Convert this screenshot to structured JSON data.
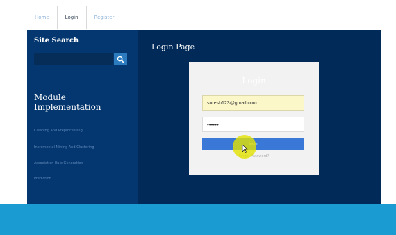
{
  "nav": {
    "tabs": [
      "Home",
      "Login",
      "Register"
    ],
    "active_index": 1
  },
  "sidebar": {
    "search_title": "Site Search",
    "search_placeholder": "",
    "search_icon": "search-icon",
    "module_heading": "Module Implementation",
    "links": [
      "Cleaning And Preprocessing",
      "Incremental Mining And Clustering",
      "Association Rule Generation",
      "Prediction"
    ]
  },
  "main": {
    "title": "Login Page",
    "login": {
      "heading": "Login",
      "email_value": "suresh123@gmail.com",
      "password_value": "••••••",
      "button_label": "login",
      "forgot_label": "Forgot Password?"
    }
  },
  "colors": {
    "sidebar_bg": "#04376f",
    "main_bg": "#022a58",
    "button_blue": "#3a78d8",
    "footer_band": "#1a9bd1",
    "cursor_highlight": "#e2e200"
  }
}
